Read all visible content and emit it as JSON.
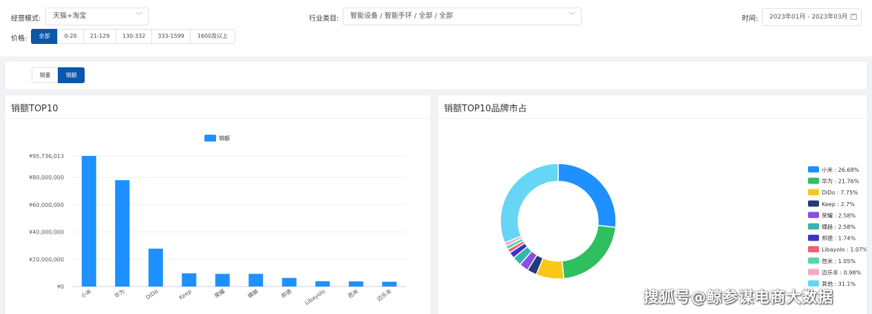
{
  "filters": {
    "mode_label": "经营模式:",
    "mode_value": "天猫+淘宝",
    "industry_label": "行业类目:",
    "industry_value": "智能设备 / 智能手环 / 全部 / 全部",
    "time_label": "时间:",
    "time_value": "2023年01月 - 2023年03月",
    "price_label": "价格:",
    "price_options": [
      "全部",
      "0-20",
      "21-129",
      "130-332",
      "333-1599",
      "1600及以上"
    ],
    "price_active": "全部"
  },
  "metric_toggle": {
    "options": [
      "销量",
      "销额"
    ],
    "active": "销额"
  },
  "bar_card": {
    "title": "销额TOP10"
  },
  "pie_card": {
    "title": "销额TOP10品牌市占"
  },
  "watermark": "搜狐号@鲸参谋电商大数据",
  "colors": {
    "accent": "#0b57a8",
    "bar": "#1e90ff"
  },
  "chart_data": [
    {
      "type": "bar",
      "title": "",
      "legend": [
        "销额"
      ],
      "legend_position": "top-center",
      "categories": [
        "小米",
        "华为",
        "DiDo",
        "Keep",
        "荣耀",
        "蝶赫",
        "邦德",
        "Libayolo",
        "芭米",
        "迈乐丰"
      ],
      "values": [
        95736013,
        78000000,
        27800000,
        9700000,
        9300000,
        9300000,
        6300000,
        3900000,
        3800000,
        3500000
      ],
      "ylim": [
        0,
        95736013
      ],
      "y_ticks": [
        "¥95,736,013",
        "¥80,000,000",
        "¥60,000,000",
        "¥40,000,000",
        "¥20,000,000",
        "¥0"
      ],
      "y_tick_values": [
        95736013,
        80000000,
        60000000,
        40000000,
        20000000,
        0
      ],
      "grid": true
    },
    {
      "type": "pie",
      "legend_position": "right",
      "slices": [
        {
          "name": "小米",
          "value": 26.68,
          "label": "小米 : 26.68%",
          "color": "#1e90ff"
        },
        {
          "name": "华为",
          "value": 21.76,
          "label": "华为 : 21.76%",
          "color": "#2fbf5f"
        },
        {
          "name": "DiDo",
          "value": 7.75,
          "label": "DiDo : 7.75%",
          "color": "#f9c817"
        },
        {
          "name": "Keep",
          "value": 2.7,
          "label": "Keep : 2.7%",
          "color": "#233a78"
        },
        {
          "name": "荣耀",
          "value": 2.58,
          "label": "荣耀 : 2.58%",
          "color": "#8b4fe0"
        },
        {
          "name": "蝶赫",
          "value": 2.58,
          "label": "蝶赫 : 2.58%",
          "color": "#36b5b0"
        },
        {
          "name": "邦德",
          "value": 1.74,
          "label": "邦德 : 1.74%",
          "color": "#3c33c4"
        },
        {
          "name": "Libayolo",
          "value": 1.07,
          "label": "Libayolo : 1.07%",
          "color": "#ee5f7a"
        },
        {
          "name": "芭米",
          "value": 1.05,
          "label": "芭米 : 1.05%",
          "color": "#50d8a8"
        },
        {
          "name": "迈乐丰",
          "value": 0.98,
          "label": "迈乐丰 : 0.98%",
          "color": "#f7a6c6"
        },
        {
          "name": "其他",
          "value": 31.1,
          "label": "其他 : 31.1%",
          "color": "#67d5f5"
        }
      ]
    }
  ]
}
